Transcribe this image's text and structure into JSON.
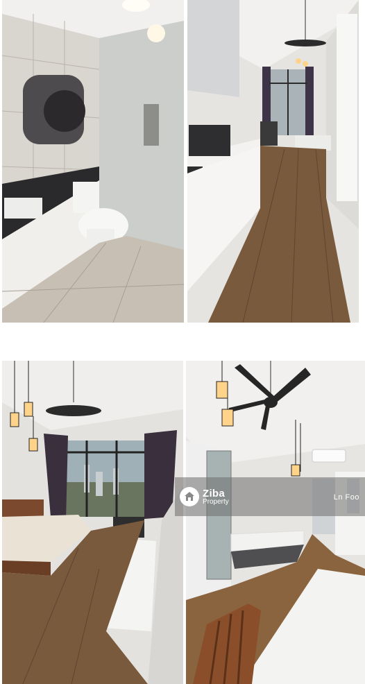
{
  "photos": [
    {
      "scene": "bathroom"
    },
    {
      "scene": "kitchen-corridor"
    },
    {
      "scene": "bedroom-window"
    },
    {
      "scene": "studio-overview"
    }
  ],
  "watermark": {
    "brand": "Ziba",
    "sub": "Property",
    "author": "Ln Foo",
    "icon": "house-logo-icon"
  },
  "colors": {
    "floor_wood": "#7a5a3c",
    "wall": "#e8e6e3",
    "curtain": "#3a2f3d",
    "tile": "#c9c2b8"
  }
}
